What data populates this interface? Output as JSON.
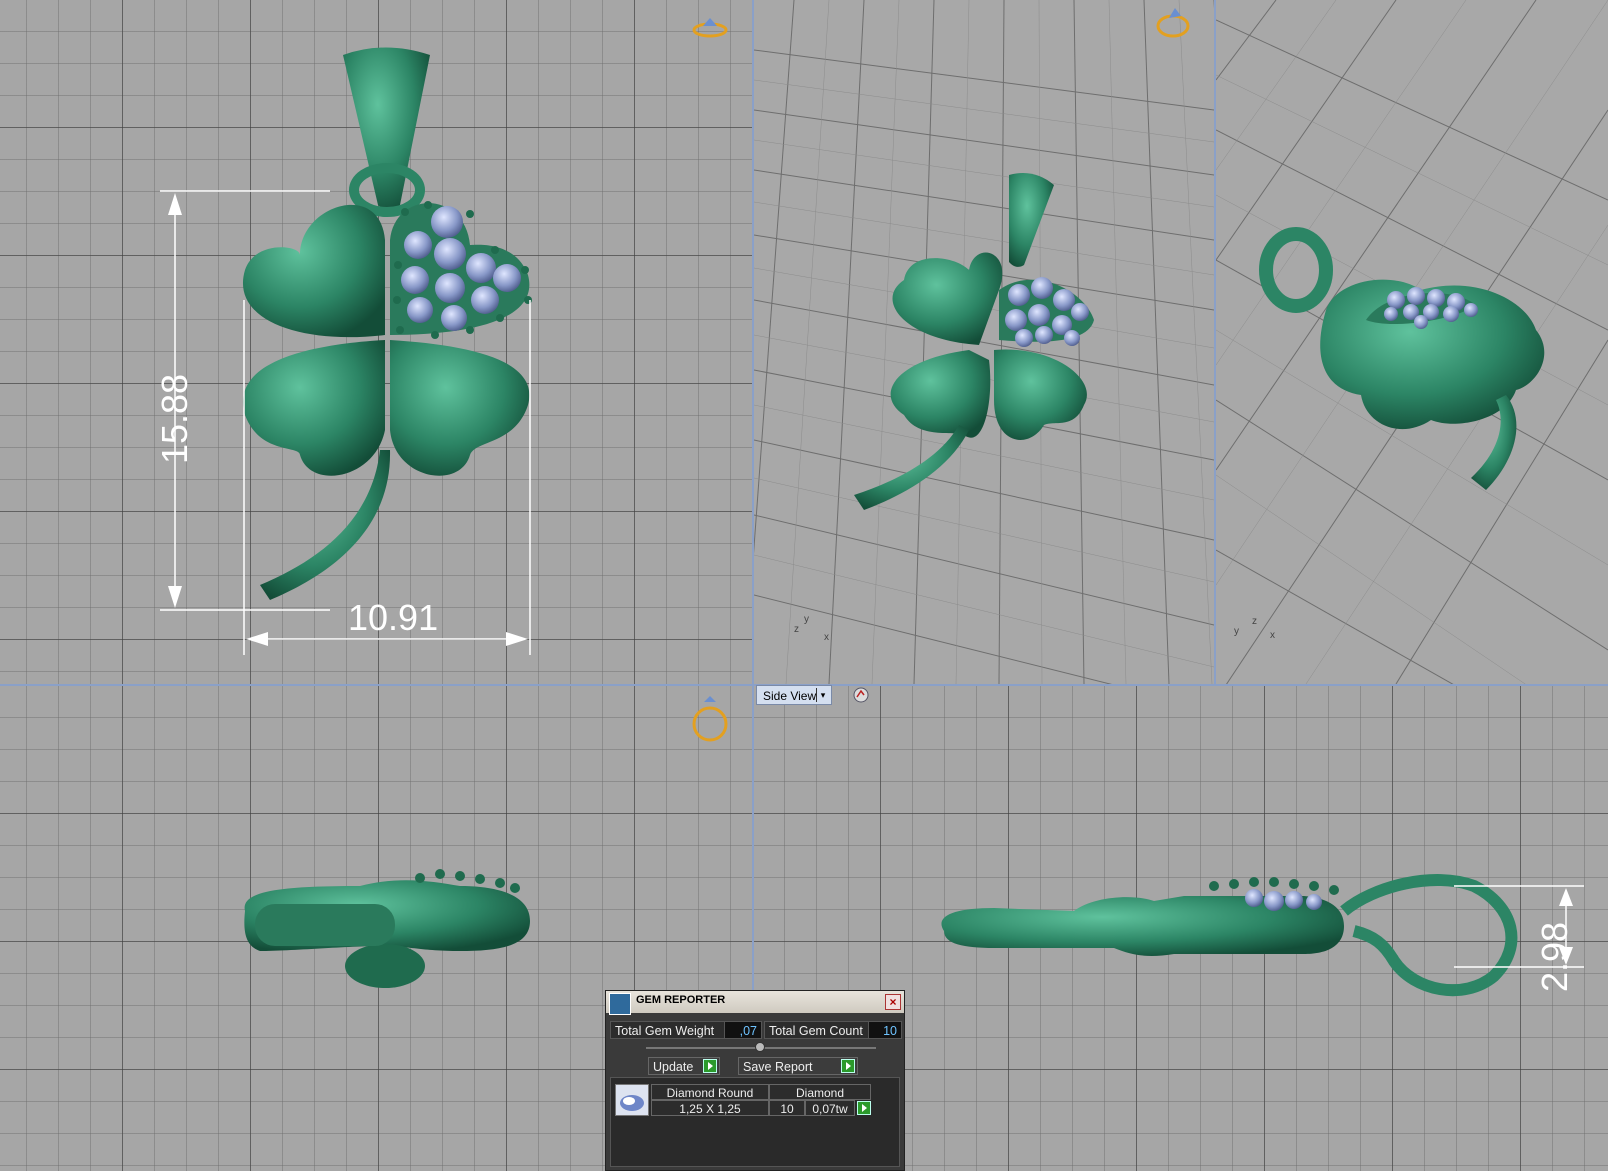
{
  "views": {
    "top_left": {
      "dimensions": {
        "height": "15.88",
        "width": "10.91"
      }
    },
    "bottom_right": {
      "label": "Side View",
      "dimensions": {
        "thickness": "2.98"
      }
    },
    "axis_labels": {
      "persp1": [
        "y",
        "z",
        "x"
      ],
      "persp2": [
        "y",
        "z",
        "x"
      ]
    }
  },
  "gem_reporter": {
    "title": "GEM REPORTER",
    "total_gem_weight_label": "Total Gem Weight",
    "total_gem_weight_value": ",07",
    "total_gem_count_label": "Total Gem Count",
    "total_gem_count_value": "10",
    "update_label": "Update",
    "save_report_label": "Save Report",
    "table": {
      "col1_header": "Diamond Round",
      "col2_header": "Diamond",
      "size": "1,25 X 1,25",
      "count": "10",
      "weight": "0,07tw"
    }
  },
  "colors": {
    "metal": "#2e8a6a",
    "gem": "#8fa0c8",
    "ring_icon": "#e3a020"
  }
}
